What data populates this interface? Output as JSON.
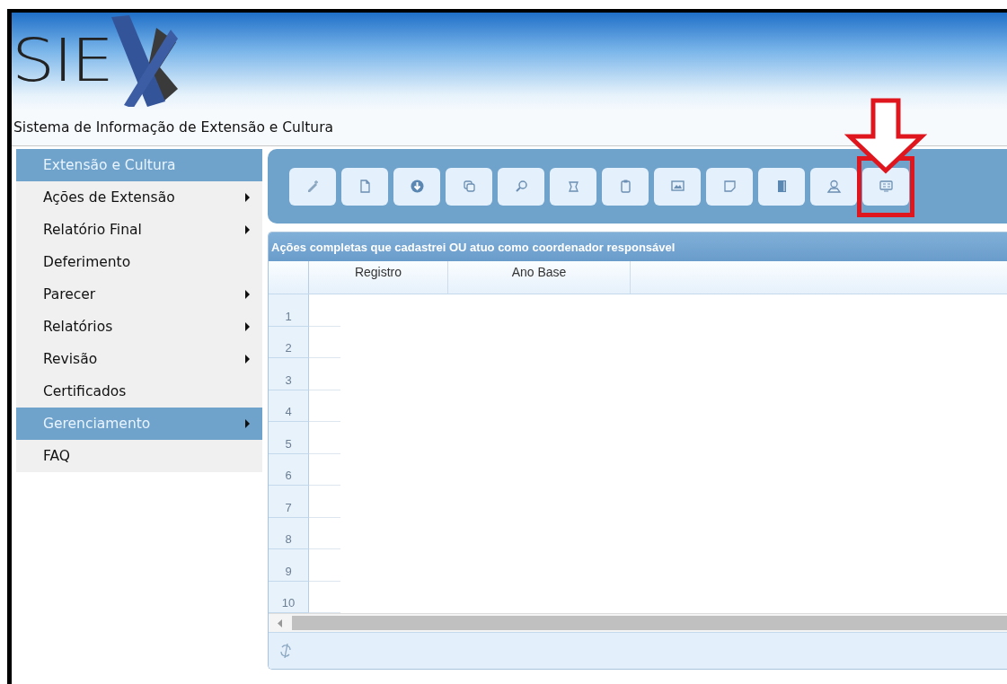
{
  "header": {
    "logo_text": "SIE",
    "subtitle": "Sistema de Informação de Extensão e Cultura"
  },
  "sidebar": {
    "items": [
      {
        "label": "Extensão e Cultura",
        "kind": "header",
        "has_submenu": false
      },
      {
        "label": "Ações de Extensão",
        "kind": "item",
        "has_submenu": true,
        "selected": false
      },
      {
        "label": "Relatório Final",
        "kind": "item",
        "has_submenu": true,
        "selected": false
      },
      {
        "label": "Deferimento",
        "kind": "item",
        "has_submenu": false,
        "selected": false
      },
      {
        "label": "Parecer",
        "kind": "item",
        "has_submenu": true,
        "selected": false
      },
      {
        "label": "Relatórios",
        "kind": "item",
        "has_submenu": true,
        "selected": false
      },
      {
        "label": "Revisão",
        "kind": "item",
        "has_submenu": true,
        "selected": false
      },
      {
        "label": "Certificados",
        "kind": "item",
        "has_submenu": false,
        "selected": false
      },
      {
        "label": "Gerenciamento",
        "kind": "item",
        "has_submenu": true,
        "selected": true
      },
      {
        "label": "FAQ",
        "kind": "item",
        "has_submenu": false,
        "selected": false
      }
    ]
  },
  "toolbar": {
    "buttons": [
      {
        "kind": "pencil",
        "highlighted": false
      },
      {
        "kind": "file",
        "highlighted": false
      },
      {
        "kind": "download",
        "highlighted": false
      },
      {
        "kind": "copy",
        "highlighted": false
      },
      {
        "kind": "search",
        "highlighted": false
      },
      {
        "kind": "scroll",
        "highlighted": false
      },
      {
        "kind": "clipboard",
        "highlighted": false
      },
      {
        "kind": "image",
        "highlighted": false
      },
      {
        "kind": "note",
        "highlighted": false
      },
      {
        "kind": "notebook",
        "highlighted": false
      },
      {
        "kind": "user",
        "highlighted": false
      },
      {
        "kind": "card",
        "highlighted": true
      }
    ]
  },
  "grid": {
    "title": "Ações completas que cadastrei OU atuo como coordenador responsável",
    "columns": [
      "Registro",
      "Ano Base"
    ],
    "row_numbers": [
      "1",
      "2",
      "3",
      "4",
      "5",
      "6",
      "7",
      "8",
      "9",
      "10"
    ]
  }
}
